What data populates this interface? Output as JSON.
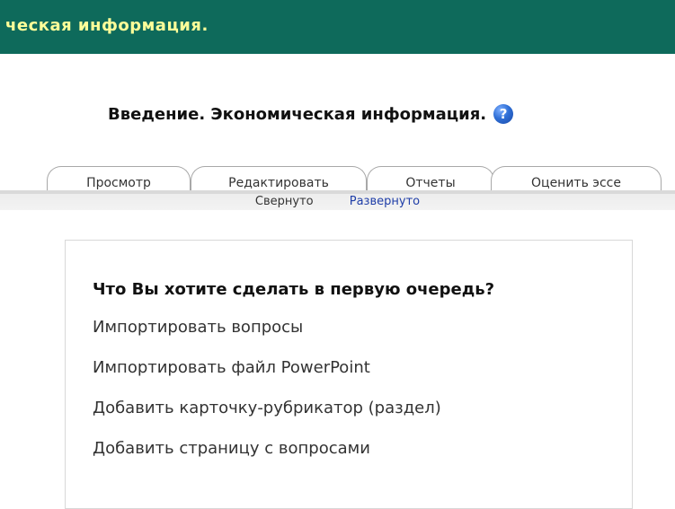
{
  "header": {
    "title": "ческая информация."
  },
  "page": {
    "heading": "Введение. Экономическая информация.",
    "help_icon_glyph": "?"
  },
  "tabs": [
    {
      "label": "Просмотр"
    },
    {
      "label": "Редактировать"
    },
    {
      "label": "Отчеты"
    },
    {
      "label": "Оценить эссе"
    }
  ],
  "subnav": {
    "collapsed": "Свернуто",
    "expanded": "Развернуто"
  },
  "panel": {
    "heading": "Что Вы хотите сделать в первую очередь?",
    "actions": [
      "Импортировать вопросы",
      "Импортировать файл PowerPoint",
      "Добавить карточку-рубрикатор (раздел)",
      "Добавить страницу с вопросами"
    ]
  },
  "colors": {
    "header_bg": "#0e6a5b",
    "header_text": "#ffff99",
    "link_blue": "#1f3ea8"
  },
  "icons": {
    "help": "help-icon"
  }
}
